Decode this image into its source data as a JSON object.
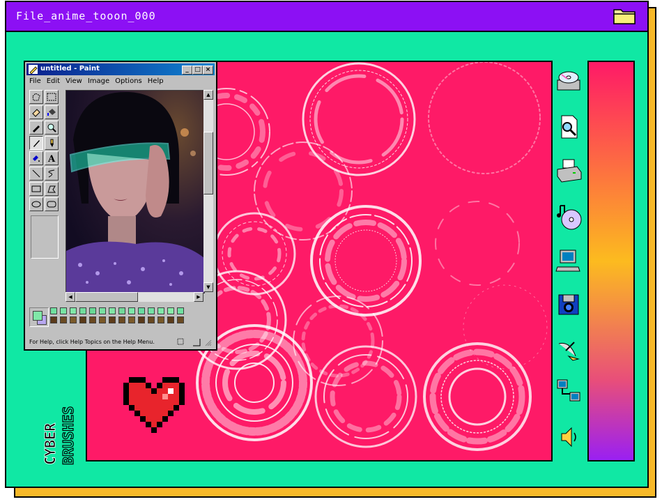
{
  "window": {
    "title": "File_anime_tooon_000"
  },
  "paint": {
    "title": "untitled - Paint",
    "menu": [
      "File",
      "Edit",
      "View",
      "Image",
      "Options",
      "Help"
    ],
    "status": "For Help, click Help Topics on the Help Menu.",
    "buttons": {
      "minimize": "_",
      "maximize": "□",
      "close": "×"
    }
  },
  "decor": {
    "line1": "CYBER",
    "line2": "BRUSHES"
  },
  "side_icons": [
    "cd-drive-icon",
    "search-document-icon",
    "printer-icon",
    "music-cd-icon",
    "computer-icon",
    "camera-floppy-icon",
    "satellite-dish-icon",
    "network-icon",
    "speaker-icon"
  ],
  "colors": {
    "purple": "#8c10f4",
    "mint": "#10e8a4",
    "pink": "#fe1a67",
    "gold": "#f6b828"
  }
}
